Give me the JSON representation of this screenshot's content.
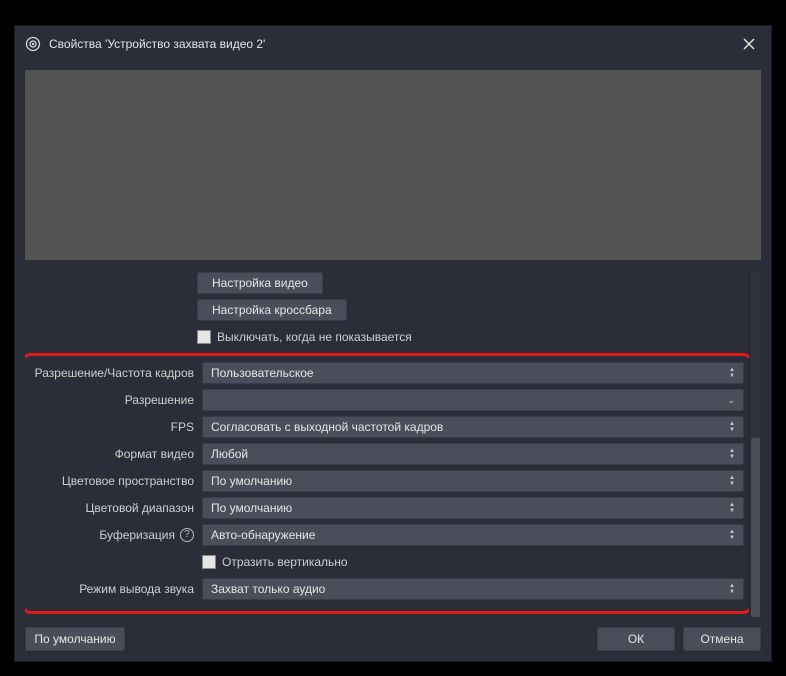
{
  "title": "Свойства 'Устройство захвата видео 2'",
  "buttons": {
    "video_config": "Настройка видео",
    "crossbar_config": "Настройка кроссбара"
  },
  "checkboxes": {
    "deactivate_hidden": "Выключать, когда не показывается",
    "flip_vertical": "Отразить вертикально"
  },
  "fields": {
    "resolution_fps": {
      "label": "Разрешение/Частота кадров",
      "value": "Пользовательское"
    },
    "resolution": {
      "label": "Разрешение",
      "value": ""
    },
    "fps": {
      "label": "FPS",
      "value": "Согласовать с выходной частотой кадров"
    },
    "video_format": {
      "label": "Формат видео",
      "value": "Любой"
    },
    "color_space": {
      "label": "Цветовое пространство",
      "value": "По умолчанию"
    },
    "color_range": {
      "label": "Цветовой диапазон",
      "value": "По умолчанию"
    },
    "buffering": {
      "label": "Буферизация",
      "value": "Авто-обнаружение"
    },
    "audio_output": {
      "label": "Режим вывода звука",
      "value": "Захват только аудио"
    }
  },
  "footer": {
    "defaults": "По умолчанию",
    "ok": "ОК",
    "cancel": "Отмена"
  },
  "help_glyph": "?"
}
